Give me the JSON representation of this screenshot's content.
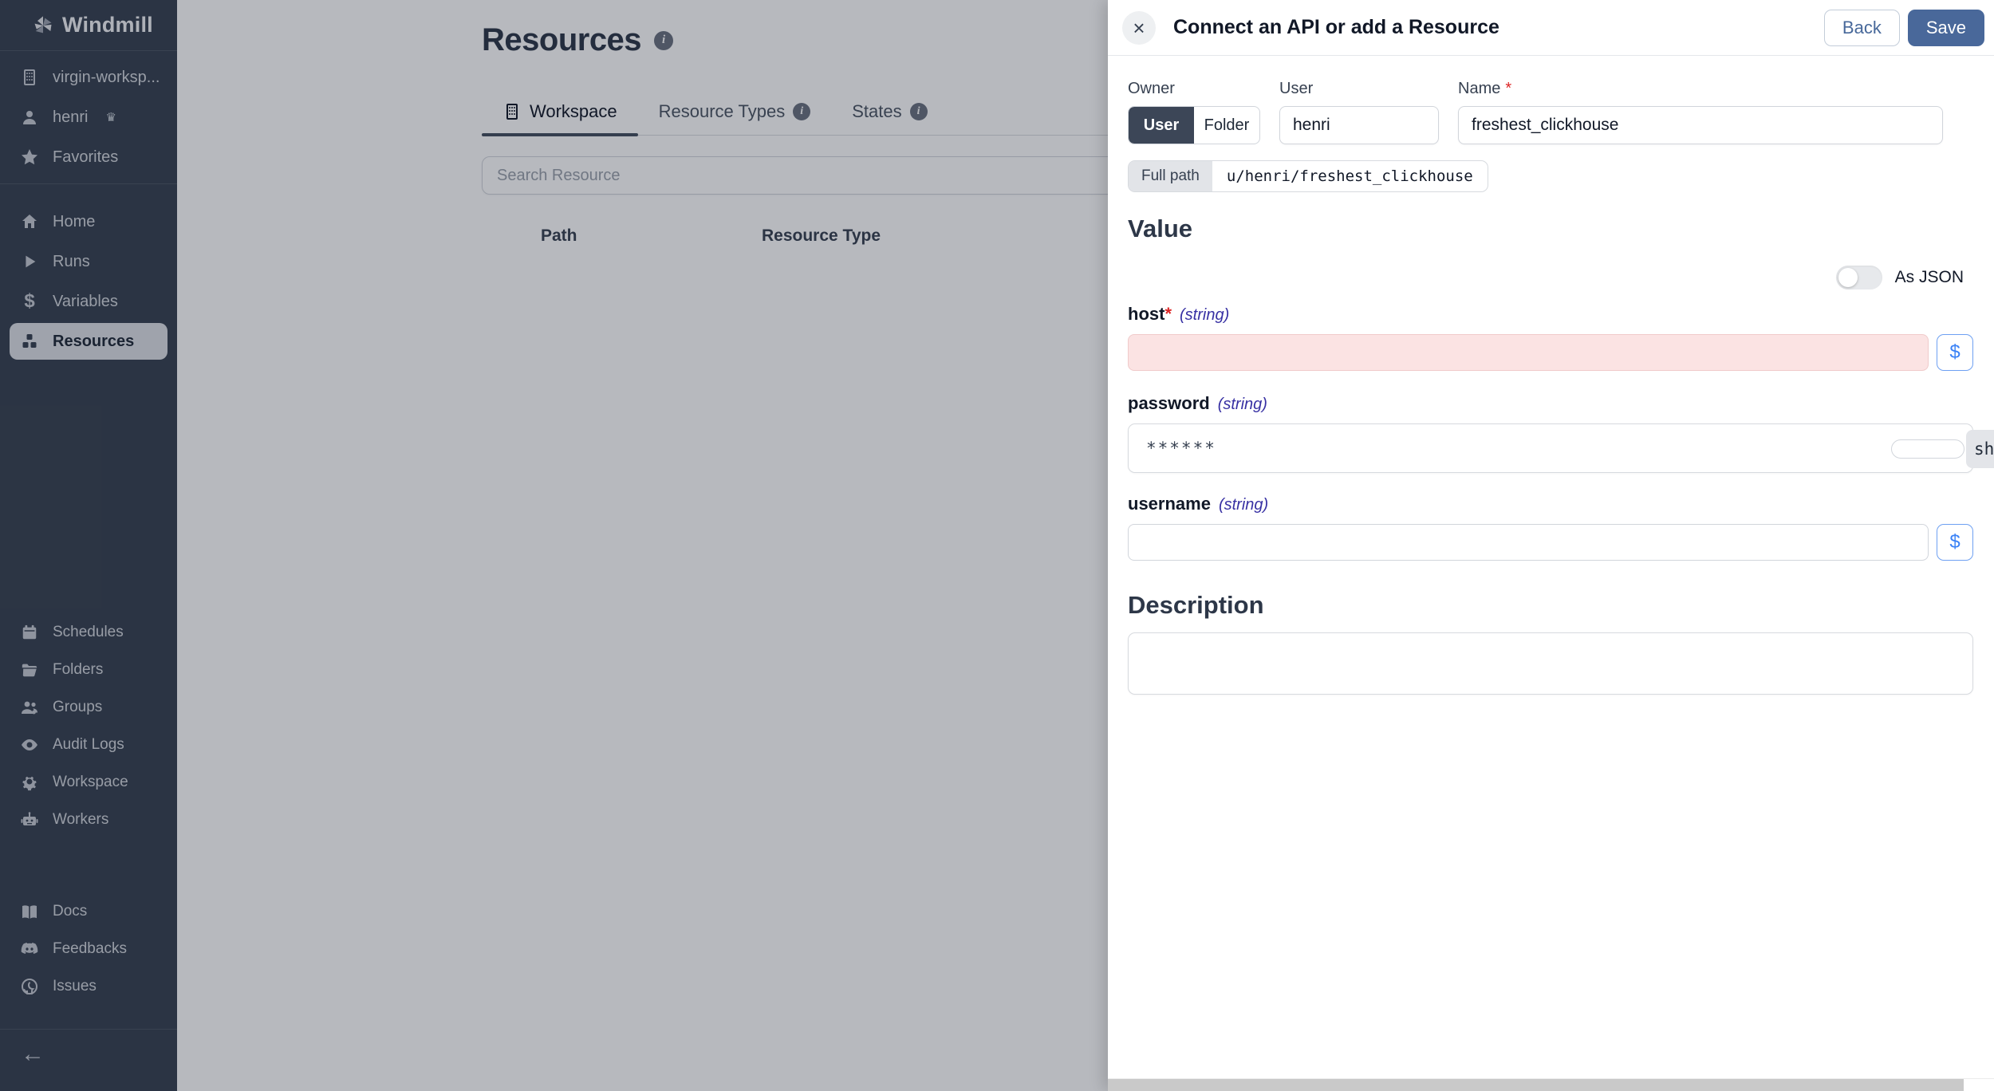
{
  "sidebar": {
    "logo_text": "Windmill",
    "workspace_name": "virgin-worksp...",
    "user_name": "henri",
    "favorites_label": "Favorites",
    "nav": [
      {
        "label": "Home",
        "icon": "home-icon"
      },
      {
        "label": "Runs",
        "icon": "play-icon"
      },
      {
        "label": "Variables",
        "icon": "dollar-icon"
      },
      {
        "label": "Resources",
        "icon": "cubes-icon",
        "active": true
      }
    ],
    "nav2": [
      {
        "label": "Schedules",
        "icon": "calendar-icon"
      },
      {
        "label": "Folders",
        "icon": "folder-icon"
      },
      {
        "label": "Groups",
        "icon": "users-icon"
      },
      {
        "label": "Audit Logs",
        "icon": "eye-icon"
      },
      {
        "label": "Workspace",
        "icon": "gear-icon"
      },
      {
        "label": "Workers",
        "icon": "robot-icon"
      }
    ],
    "nav3": [
      {
        "label": "Docs",
        "icon": "book-icon"
      },
      {
        "label": "Feedbacks",
        "icon": "discord-icon"
      },
      {
        "label": "Issues",
        "icon": "github-icon"
      }
    ],
    "collapse_icon": "←",
    "crown_icon": "♛"
  },
  "main": {
    "title": "Resources",
    "tabs": [
      {
        "label": "Workspace",
        "active": true,
        "icon": "building-icon"
      },
      {
        "label": "Resource Types",
        "has_info": true
      },
      {
        "label": "States",
        "has_info": true
      }
    ],
    "search_placeholder": "Search Resource",
    "table": {
      "col_path": "Path",
      "col_resource_type": "Resource Type"
    }
  },
  "drawer": {
    "title": "Connect an API or add a Resource",
    "close_icon": "×",
    "back_label": "Back",
    "save_label": "Save",
    "owner_label": "Owner",
    "owner_option_user": "User",
    "owner_option_folder": "Folder",
    "owner_selected": "User",
    "user_label": "User",
    "user_value": "henri",
    "name_label": "Name",
    "name_required_mark": "*",
    "name_value": "freshest_clickhouse",
    "full_path_label": "Full path",
    "full_path_value": "u/henri/freshest_clickhouse",
    "value_heading": "Value",
    "as_json_label": "As JSON",
    "as_json_enabled": false,
    "fields": {
      "host": {
        "label": "host",
        "required_mark": "*",
        "type": "(string)",
        "value": "",
        "invalid": true
      },
      "password": {
        "label": "password",
        "type": "(string)",
        "value": "******",
        "show_chip_text": "sh"
      },
      "username": {
        "label": "username",
        "type": "(string)",
        "value": ""
      }
    },
    "dollar_button_label": "$",
    "description_heading": "Description",
    "description_value": ""
  },
  "colors": {
    "sidebar_bg": "#374151",
    "accent_blue": "#49689a",
    "link_blue": "#3b82f6",
    "error_bg": "#fbe3e3",
    "type_hint": "#3730a3",
    "required_red": "#dc2626"
  }
}
